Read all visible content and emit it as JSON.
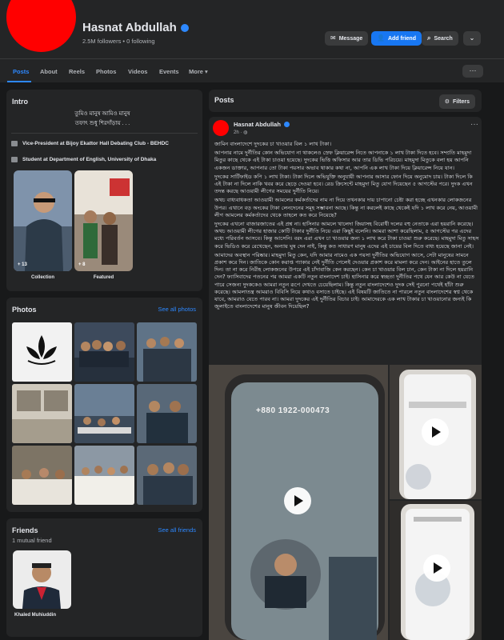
{
  "profile": {
    "name": "Hasnat Abdullah",
    "followers": "2.5M followers • 0 following"
  },
  "actions": {
    "message": "Message",
    "add_friend": "Add friend",
    "search": "Search"
  },
  "tabs": [
    "Posts",
    "About",
    "Reels",
    "Photos",
    "Videos",
    "Events",
    "More"
  ],
  "intro": {
    "title": "Intro",
    "bio_line1": "তুমিও মানুষ আমিও মানুষ",
    "bio_line2": "তফাৎ শুধু শিরদাঁড়ায় . . .",
    "info": [
      "Vice-President at Bijoy Ekattor Hall Debating Club - BEHDC",
      "Student at Department of English, University of Dhaka"
    ],
    "featured": [
      {
        "label": "Collection",
        "count": "+ 13"
      },
      {
        "label": "Featured",
        "count": "+ 8"
      }
    ]
  },
  "photos": {
    "title": "Photos",
    "see_all": "See all photos"
  },
  "friends": {
    "title": "Friends",
    "see_all": "See all friends",
    "mutual": "1 mutual friend",
    "friend_name": "Khaled Muhiuddin"
  },
  "posts_header": {
    "title": "Posts",
    "filters": "Filters"
  },
  "post": {
    "author": "Hasnat Abdullah",
    "time": "2h ·",
    "paragraphs": [
      "জামিন বাংলাদেশে দুদকের চা খাওয়ার বিল ১ লাখ টাকা।",
      "আপনার নামে দুর্নীতির কোন অভিযোগ না থাকলেও স্রেফ ক্লিয়ারেন্স নিতে আপনাকে ১ লাখ টাকা দিতে হবে। সম্প্রতি মাহমুদা মিতুর কাছে থেকে এই টাকা চাওয়া হয়েছে। দুদকের ভিত্তি অফিসার আর তার ডিভি পরিচয়ে। মাহমুদা মিতুকে বলা হয় আপনি একজন ডাক্তার, আপনার তো টাকা পয়সার অভাব থাকার কথা না, আপনি এক লাখ টাকা দিয়ে ক্লিয়ারেন্স নিয়ে যান।",
      "দুদকের সার্টিফাইড কপি ১ লাখ টাকা। টাকা দিলে অভিযুক্তি অনুযায়ী আপনার আসার ফোন দিয়ে অনুমোদ চায়। টাকা দিলে কি এই টাকা না দিলে নাকি খবর করে ছেড়ে দেওয়া হবে। রেড ক্রিসেন্টে মাহমুদা মিতু যোগ দিয়েছেন ৫ আগস্টের পরে। দুদক এখন তদন্ত করছে আওয়ামী লীগের সময়ের দুর্নীতি নিয়ে।",
      "অথচ বাধ্যবাধকতা আওয়ামী আমলের কর্মকর্তাদের নাম না দিয়ে তখনকার দায় চাপানো চেষ্টা করা হচ্ছে এখনকার লোকজনের উপর। এখানে বড় অংকের টাকা লেনদেনের সমূহ সম্ভাবনা আছে। কিন্তু না করলেই কাছে থেকেই যদি ১ লাখ করে নেয়, আওয়ামী লীগ আমলের কর্মকর্তাদের থেকে তাহলে কত করে নিয়েছে?",
      "দুদকের এখনো বাজারজাতের এই প্রশ্ন না। হাসিনার আমলে খালেদা জিয়াসহ বিরোধী দলের বহু নেতাকে এরা হয়রানি করেছে। অথচ আওয়ামী লীগের হাজার কোটি টাকার দুর্নীতি নিয়ে এরা কিছুই বলেনি। আমরা আশা করেছিলাম, ৫ আগস্টের পর এদের মধ্যে পরিবর্তন আসবে। কিন্তু আসেনি। বরং এরা এখন চা খাওয়ার জন্য ১ লাখ করে টাকা চাওয়া শুরু করেছে। মাহমুদা মিতু সাহস করে ভিডিও করে রেখেছেন, অন্যায় ঘুষ দেন নাই, কিন্তু কত সাধারণ মানুষ এদের এই চায়ের বিল দিতে বাধ্য হয়েছে জানা নেই।",
      "আমাদের অবস্থান পরিষ্কার। মাহমুদা মিতু কেন, যদি আমার নামেও এক পয়সা দুর্নীতির অভিযোগ আসে, সেটা মানুষের সামনে প্রকাশ করে দিন। জাতিকে কোন করাপ্ত প্যাকার নেই দুর্নীতি পেলেই দেওয়ার প্রকাশ করে মামলা করে দেন। আইনের হাতে তুলে দিন। তা না করে নিরীহ লোকজনের উপরে এই চাঁদাবাজি কেন করছেন। কেন চা খাওয়ার বিল চান, কেন টাকা না দিলে হয়রানি দেন? ফ্যাসিবাদের পতনের পর আমরা একটি নতুন বাংলাদেশ চাই। হাসিনার করে স্বচ্ছতা দুর্নীতির পথে যেন আর কেউ না যেতে পারে সেজন্য দুদককেও আমরা নতুন রূপে দেখতে চেয়েছিলাম। কিন্তু নতুন বাংলাদেশেও দুদক সেই পুরনো পথেই হাঁটা শুরু করেছে। আমলাতন্ত্র আমরাও বিবিসি নিয়ে কথাও বসাতে চাইছে। এই বিষয়টি জাতিতে না পারলে নতুন বাংলাদেশের স্বপ্ন থেকে যাবে, আমরাও যেতে পারব না। আমরা দুদকের এই দুর্নীতির বিচার চাই। আমাদেরকে এক লাখ টাকার চা খাওয়ানোর জন্যই কি জুলাইতে বাংলাদেশের মানুষ জীবন দিয়েছিল?"
    ],
    "phone_overlay": "+880 1922-000473"
  }
}
